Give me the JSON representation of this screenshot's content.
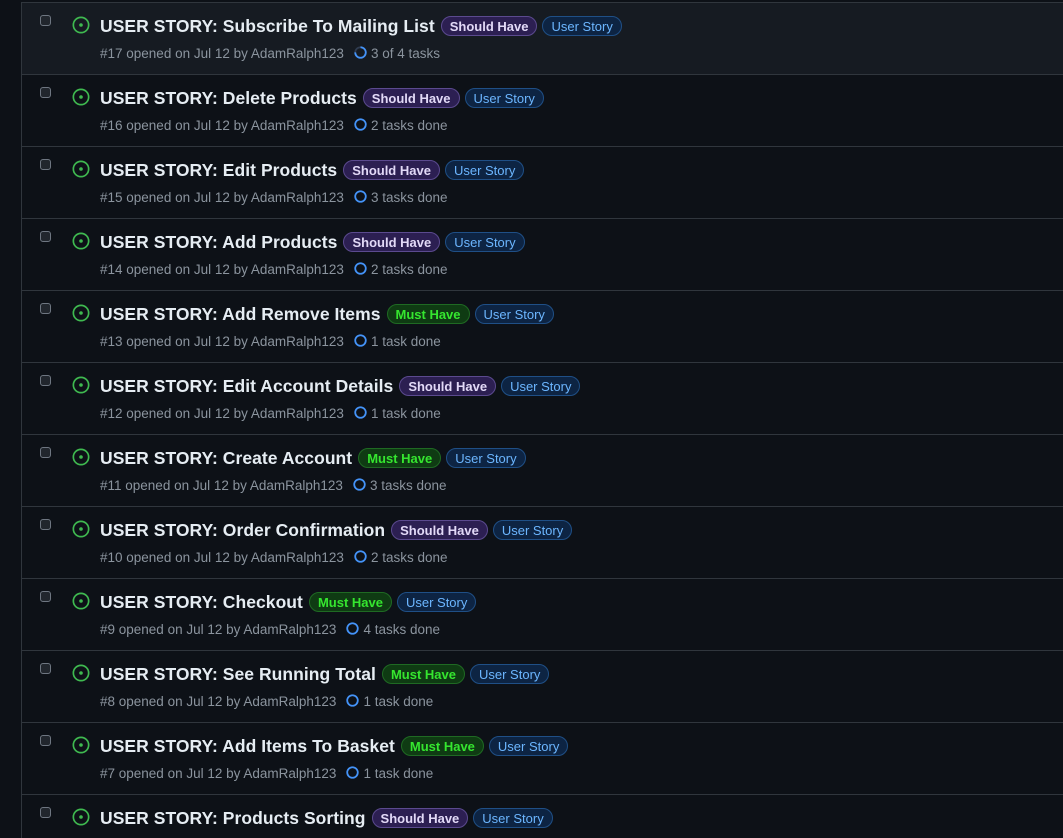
{
  "colors": {
    "background": "#0d1117",
    "row_hover": "#161b22",
    "border": "#30363d",
    "open_icon": "#3fb950",
    "task_icon": "#4493f8"
  },
  "issues": [
    {
      "title": "USER STORY: Subscribe To Mailing List",
      "priority": "Should Have",
      "priority_type": "should",
      "type_label": "User Story",
      "meta": "#17 opened on Jul 12 by AdamRalph123",
      "tasks": "3 of 4 tasks",
      "task_progress": 0.75,
      "icon": "issue-opened-icon"
    },
    {
      "title": "USER STORY: Delete Products",
      "priority": "Should Have",
      "priority_type": "should",
      "type_label": "User Story",
      "meta": "#16 opened on Jul 12 by AdamRalph123",
      "tasks": "2 tasks done",
      "task_progress": 0,
      "icon": "issue-opened-icon"
    },
    {
      "title": "USER STORY: Edit Products",
      "priority": "Should Have",
      "priority_type": "should",
      "type_label": "User Story",
      "meta": "#15 opened on Jul 12 by AdamRalph123",
      "tasks": "3 tasks done",
      "task_progress": 0,
      "icon": "issue-opened-icon"
    },
    {
      "title": "USER STORY: Add Products",
      "priority": "Should Have",
      "priority_type": "should",
      "type_label": "User Story",
      "meta": "#14 opened on Jul 12 by AdamRalph123",
      "tasks": "2 tasks done",
      "task_progress": 0,
      "icon": "issue-opened-icon"
    },
    {
      "title": "USER STORY: Add Remove Items",
      "priority": "Must Have",
      "priority_type": "must",
      "type_label": "User Story",
      "meta": "#13 opened on Jul 12 by AdamRalph123",
      "tasks": "1 task done",
      "task_progress": 0,
      "icon": "issue-opened-icon"
    },
    {
      "title": "USER STORY: Edit Account Details",
      "priority": "Should Have",
      "priority_type": "should",
      "type_label": "User Story",
      "meta": "#12 opened on Jul 12 by AdamRalph123",
      "tasks": "1 task done",
      "task_progress": 0,
      "icon": "issue-opened-icon"
    },
    {
      "title": "USER STORY: Create Account",
      "priority": "Must Have",
      "priority_type": "must",
      "type_label": "User Story",
      "meta": "#11 opened on Jul 12 by AdamRalph123",
      "tasks": "3 tasks done",
      "task_progress": 0,
      "icon": "issue-opened-icon"
    },
    {
      "title": "USER STORY: Order Confirmation",
      "priority": "Should Have",
      "priority_type": "should",
      "type_label": "User Story",
      "meta": "#10 opened on Jul 12 by AdamRalph123",
      "tasks": "2 tasks done",
      "task_progress": 0,
      "icon": "issue-opened-icon"
    },
    {
      "title": "USER STORY: Checkout",
      "priority": "Must Have",
      "priority_type": "must",
      "type_label": "User Story",
      "meta": "#9 opened on Jul 12 by AdamRalph123",
      "tasks": "4 tasks done",
      "task_progress": 0,
      "icon": "issue-opened-icon"
    },
    {
      "title": "USER STORY: See Running Total",
      "priority": "Must Have",
      "priority_type": "must",
      "type_label": "User Story",
      "meta": "#8 opened on Jul 12 by AdamRalph123",
      "tasks": "1 task done",
      "task_progress": 0,
      "icon": "issue-opened-icon"
    },
    {
      "title": "USER STORY: Add Items To Basket",
      "priority": "Must Have",
      "priority_type": "must",
      "type_label": "User Story",
      "meta": "#7 opened on Jul 12 by AdamRalph123",
      "tasks": "1 task done",
      "task_progress": 0,
      "icon": "issue-opened-icon"
    },
    {
      "title": "USER STORY: Products Sorting",
      "priority": "Should Have",
      "priority_type": "should",
      "type_label": "User Story",
      "meta": "",
      "tasks": "",
      "task_progress": 0,
      "icon": "issue-opened-icon"
    }
  ]
}
